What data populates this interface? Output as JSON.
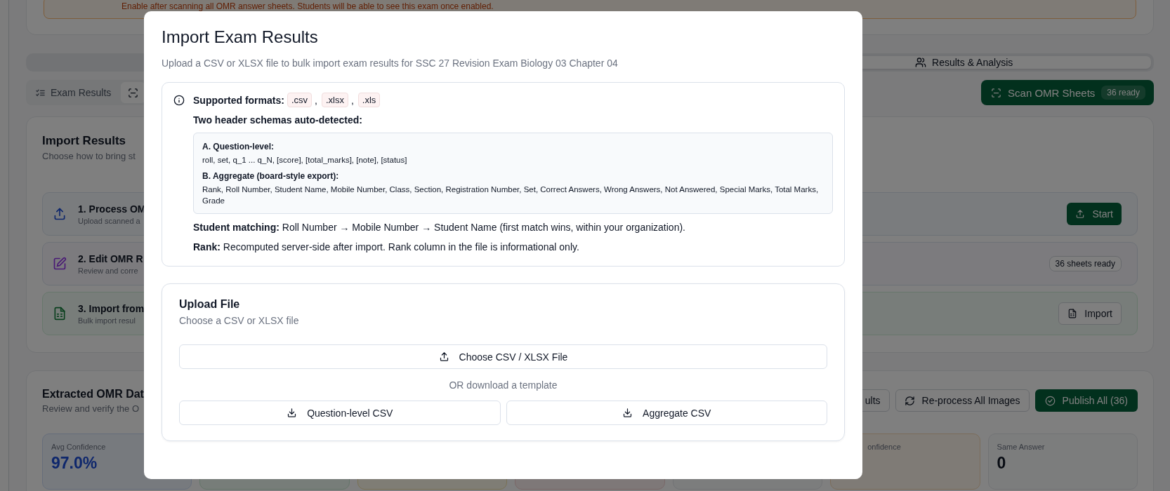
{
  "page": {
    "notice": "Enable after scanning all OMR answer sheets. Students will be able to see this exam once enabled.",
    "tabs": [
      {
        "label": "Results & Analysis",
        "selected": true
      }
    ],
    "subtabs": [
      {
        "label": "Exam Results",
        "selected": false
      },
      {
        "selected": true
      }
    ],
    "scan_button": {
      "label": "Scan OMR Sheets",
      "badge": "36 ready"
    },
    "import_card": {
      "title": "Import Results",
      "subtitle": "Choose how to bring st",
      "steps": [
        {
          "kind": "process",
          "title": "1. Process OM",
          "description": "Upload scanned a",
          "action": {
            "kind": "primary",
            "label": "Start"
          }
        },
        {
          "kind": "edit",
          "title": "2. Edit OMR R",
          "description": "Review and corre",
          "action": {
            "kind": "badge",
            "label": "36 sheets ready"
          }
        },
        {
          "kind": "import",
          "title": "3. Import from",
          "description": "Bulk import resul",
          "action": {
            "kind": "outline",
            "label": "Import"
          }
        }
      ]
    },
    "extracted_card": {
      "title": "Extracted OMR Dat",
      "subtitle": "Review and verify the O",
      "actions": [
        {
          "kind": "plain",
          "label": "ults"
        },
        {
          "kind": "reprocess",
          "label": "Re-process All Images"
        },
        {
          "kind": "publish",
          "label": "Publish All (36)"
        }
      ],
      "stats": [
        {
          "kind": "info",
          "label": "Avg Confidence",
          "value": "97.0%"
        },
        {
          "kind": "success"
        },
        {
          "kind": "warning"
        },
        {
          "kind": "danger"
        },
        {
          "kind": "neutral"
        },
        {
          "kind": "caution",
          "label": "onfidence"
        },
        {
          "kind": "neutral",
          "label": "Same Answer",
          "value": "0"
        }
      ]
    }
  },
  "dialog": {
    "title": "Import Exam Results",
    "subtitle": "Upload a CSV or XLSX file to bulk import exam results for SSC 27 Revision Exam Biology 03 Chapter 04",
    "info": {
      "formats_label": "Supported formats:",
      "formats": [
        ".csv",
        ".xlsx",
        ".xls"
      ],
      "separator": ",",
      "schemas_heading": "Two header schemas auto-detected:",
      "schemas": [
        {
          "title": "A. Question-level:",
          "columns": "roll, set, q_1 ... q_N, [score], [total_marks], [note], [status]"
        },
        {
          "title": "B. Aggregate (board-style export):",
          "columns": "Rank, Roll Number, Student Name, Mobile Number, Class, Section, Registration Number, Set, Correct Answers, Wrong Answers, Not Answered, Special Marks, Total Marks, Grade"
        }
      ],
      "notes": [
        "**Student matching:** Roll Number → Mobile Number → Student Name (first match wins, within your organization).",
        "**Rank:** Recomputed server-side after import. Rank column in the file is informational only."
      ]
    },
    "upload": {
      "title": "Upload File",
      "subtitle": "Choose a CSV or XLSX file",
      "choose_button": "Choose CSV / XLSX File",
      "divider_text": "OR download a template",
      "templates": [
        "Question-level CSV",
        "Aggregate CSV"
      ]
    }
  }
}
